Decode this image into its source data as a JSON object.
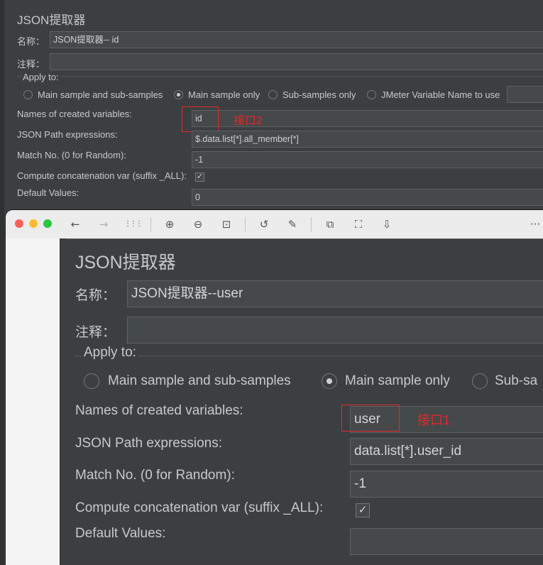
{
  "back": {
    "title": "JSON提取器",
    "name_label": "名称：",
    "name_value": "JSON提取器-- id",
    "comment_label": "注释：",
    "comment_value": "",
    "apply_to": "Apply to:",
    "radios": [
      "Main sample and sub-samples",
      "Main sample only",
      "Sub-samples only",
      "JMeter Variable Name to use"
    ],
    "selected_radio": "Main sample only",
    "names_label": "Names of created variables:",
    "names_value": "id",
    "annotation": "接口2",
    "path_label": "JSON Path expressions:",
    "path_value": "$.data.list[*].all_member[*]",
    "match_label": "Match No. (0 for Random):",
    "match_value": "-1",
    "concat_label": "Compute concatenation var (suffix _ALL):",
    "concat_checked": "✓",
    "default_label": "Default Values:",
    "default_value": "0"
  },
  "toolbar": {
    "icons": [
      "close-dot",
      "minimize-dot",
      "zoom-dot",
      "back-arrow-icon",
      "forward-arrow-icon",
      "grid-icon",
      "zoom-in-icon",
      "zoom-out-icon",
      "actual-size-icon",
      "rotate-icon",
      "markup-icon",
      "translate-icon",
      "scan-icon",
      "save-icon",
      "more-icon"
    ],
    "glyphs": {
      "back": "←",
      "forward": "→",
      "grid": "⋮⋮⋮",
      "zoom_in": "⊕",
      "zoom_out": "⊖",
      "actual": "⊡",
      "rotate": "↺",
      "markup": "✎",
      "translate": "⧉",
      "scan": "⛶",
      "save": "⇩",
      "more": "···"
    }
  },
  "front": {
    "title": "JSON提取器",
    "name_label": "名称：",
    "name_value": "JSON提取器--user",
    "comment_label": "注释：",
    "comment_value": "",
    "apply_to": "Apply to:",
    "radios": [
      "Main sample and sub-samples",
      "Main sample only",
      "Sub-sa"
    ],
    "selected_radio": "Main sample only",
    "names_label": "Names of created variables:",
    "names_value": "user",
    "annotation": "接口1",
    "path_label": "JSON Path expressions:",
    "path_value": "data.list[*].user_id",
    "match_label": "Match No. (0 for Random):",
    "match_value": "-1",
    "concat_label": "Compute concatenation var (suffix _ALL):",
    "concat_checked": "✓",
    "default_label": "Default Values:",
    "default_value": ""
  },
  "colors": {
    "panel_bg": "#3c3f41",
    "field_bg": "#45494a",
    "annotation_red": "#e0292b",
    "traffic_red": "#ff5f57",
    "traffic_yellow": "#febc2e",
    "traffic_green": "#28c840"
  }
}
